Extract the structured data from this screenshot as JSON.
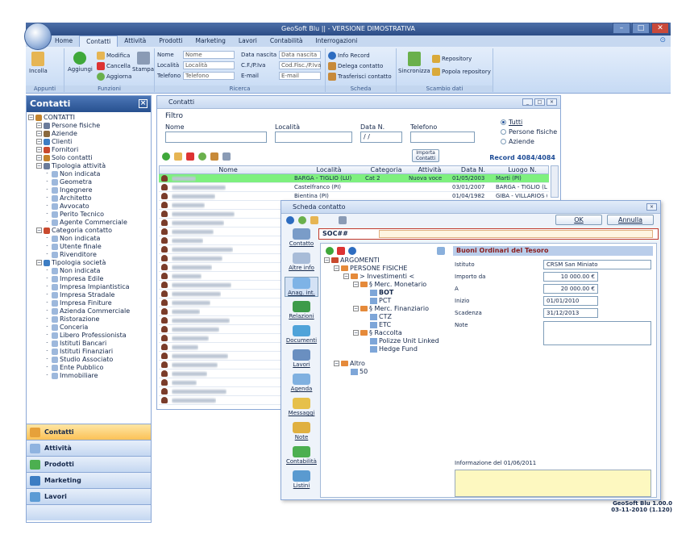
{
  "window": {
    "title": "GeoSoft Blu || - VERSIONE DIMOSTRATIVA"
  },
  "ribbon_tabs": [
    "Home",
    "Contatti",
    "Attività",
    "Prodotti",
    "Marketing",
    "Lavori",
    "Contabilità",
    "Interrogazioni"
  ],
  "ribbon": {
    "appunti": {
      "label": "Appunti",
      "incolla": "Incolla"
    },
    "funzioni": {
      "label": "Funzioni",
      "aggiungi": "Aggiungi",
      "modifica": "Modifica",
      "cancella": "Cancella",
      "aggiorna": "Aggiorna",
      "stampa": "Stampa"
    },
    "ricerca": {
      "label": "Ricerca",
      "fields": [
        {
          "label": "Nome",
          "placeholder": "Nome"
        },
        {
          "label": "Località",
          "placeholder": "Località"
        },
        {
          "label": "Telefono",
          "placeholder": "Telefono"
        },
        {
          "label": "Data nascita",
          "placeholder": "Data nascita"
        },
        {
          "label": "C.F./P.Iva",
          "placeholder": "Cod.Fisc./P.Iva"
        },
        {
          "label": "E-mail",
          "placeholder": "E-mail"
        }
      ]
    },
    "scheda": {
      "label": "Scheda",
      "info": "Info Record",
      "delega": "Delega contatto",
      "trasferisci": "Trasferisci contatto"
    },
    "scambio": {
      "label": "Scambio dati",
      "sincronizza": "Sincronizza",
      "repository": "Repository",
      "popola": "Popola repository"
    }
  },
  "sidebar": {
    "title": "Contatti",
    "tree": [
      {
        "t": "CONTATTI",
        "l": 0
      },
      {
        "t": "Persone fisiche",
        "l": 1
      },
      {
        "t": "Aziende",
        "l": 1
      },
      {
        "t": "Clienti",
        "l": 1
      },
      {
        "t": "Fornitori",
        "l": 1
      },
      {
        "t": "Solo contatti",
        "l": 1
      },
      {
        "t": "Tipologia attività",
        "l": 1
      },
      {
        "t": "Non indicata",
        "l": 2
      },
      {
        "t": "Geometra",
        "l": 2
      },
      {
        "t": "Ingegnere",
        "l": 2
      },
      {
        "t": "Architetto",
        "l": 2
      },
      {
        "t": "Avvocato",
        "l": 2
      },
      {
        "t": "Perito Tecnico",
        "l": 2
      },
      {
        "t": "Agente Commerciale",
        "l": 2
      },
      {
        "t": "Categoria contatto",
        "l": 1
      },
      {
        "t": "Non indicata",
        "l": 2
      },
      {
        "t": "Utente finale",
        "l": 2
      },
      {
        "t": "Rivenditore",
        "l": 2
      },
      {
        "t": "Tipologia società",
        "l": 1
      },
      {
        "t": "Non indicata",
        "l": 2
      },
      {
        "t": "Impresa Edile",
        "l": 2
      },
      {
        "t": "Impresa Impiantistica",
        "l": 2
      },
      {
        "t": "Impresa Stradale",
        "l": 2
      },
      {
        "t": "Impresa Finiture",
        "l": 2
      },
      {
        "t": "Azienda Commerciale",
        "l": 2
      },
      {
        "t": "Ristorazione",
        "l": 2
      },
      {
        "t": "Conceria",
        "l": 2
      },
      {
        "t": "Libero Professionista",
        "l": 2
      },
      {
        "t": "Istituti Bancari",
        "l": 2
      },
      {
        "t": "Istituti Finanziari",
        "l": 2
      },
      {
        "t": "Studio Associato",
        "l": 2
      },
      {
        "t": "Ente Pubblico",
        "l": 2
      },
      {
        "t": "Immobiliare",
        "l": 2
      }
    ],
    "nav": [
      "Contatti",
      "Attività",
      "Prodotti",
      "Marketing",
      "Lavori"
    ]
  },
  "contatti_window": {
    "title": "Contatti",
    "filtro": "Filtro",
    "labels": {
      "nome": "Nome",
      "localita": "Località",
      "datan": "Data N.",
      "telefono": "Telefono"
    },
    "datan_value": "/ /",
    "radio": [
      "Tutti",
      "Persone fisiche",
      "Aziende"
    ],
    "importa": "Importa Contatti",
    "record": "Record 4084/4084",
    "columns": [
      "Nome",
      "Località",
      "Categoria",
      "Attività",
      "Data N.",
      "Luogo N."
    ],
    "rows": [
      {
        "loc": "BARGA - TIGLIO (LU)",
        "cat": "Cat 2",
        "att": "Nuova voce",
        "data": "01/05/2003",
        "luogo": "Marti (PI)"
      },
      {
        "loc": "Castelfranco (PI)",
        "cat": "",
        "att": "",
        "data": "03/01/2007",
        "luogo": "BARGA - TIGLIO (LU)"
      },
      {
        "loc": "Bientina (PI)",
        "cat": "",
        "att": "",
        "data": "01/04/1982",
        "luogo": "GIBA - VILLARIOS (CI"
      }
    ]
  },
  "scheda": {
    "title": "Scheda contatto",
    "ok": "OK",
    "annulla": "Annulla",
    "soc": "SOC##",
    "left": [
      "Contatto",
      "Altre info",
      "Anag. int.",
      "Relazioni",
      "Documenti",
      "Lavori",
      "Agenda",
      "Messaggi",
      "Note",
      "Contabilità",
      "Listini"
    ],
    "tree": [
      {
        "t": "ARGOMENTI",
        "l": 0,
        "k": "root"
      },
      {
        "t": "PERSONE FISICHE",
        "l": 1,
        "k": "f"
      },
      {
        "t": "> Investimenti <",
        "l": 2,
        "k": "f"
      },
      {
        "t": "§ Merc. Monetario",
        "l": 3,
        "k": "f"
      },
      {
        "t": "BOT",
        "l": 4,
        "k": "c",
        "b": true
      },
      {
        "t": "PCT",
        "l": 4,
        "k": "c"
      },
      {
        "t": "§ Merc. Finanziario",
        "l": 3,
        "k": "f"
      },
      {
        "t": "CTZ",
        "l": 4,
        "k": "c"
      },
      {
        "t": "ETC",
        "l": 4,
        "k": "c"
      },
      {
        "t": "§ Raccolta",
        "l": 3,
        "k": "f"
      },
      {
        "t": "Polizze Unit Linked",
        "l": 4,
        "k": "c"
      },
      {
        "t": "Hedge Fund",
        "l": 4,
        "k": "c"
      },
      {
        "t": "Altro",
        "l": 1,
        "k": "f",
        "gap": true
      },
      {
        "t": "50",
        "l": 2,
        "k": "c"
      }
    ],
    "detail": {
      "title": "Buoni Ordinari del Tesoro",
      "istituto_l": "Istituto",
      "istituto": "CRSM San Miniato",
      "importo_l": "Importo da",
      "importo": "10 000.00 €",
      "a_l": "A",
      "a": "20 000.00 €",
      "inizio_l": "Inizio",
      "inizio": "01/01/2010",
      "scad_l": "Scadenza",
      "scad": "31/12/2013",
      "note_l": "Note",
      "info": "Informazione del 01/06/2011"
    }
  },
  "footer": {
    "version": "GeoSoft Blu 1.00.0",
    "date": "03-11-2010 (1.120)"
  }
}
